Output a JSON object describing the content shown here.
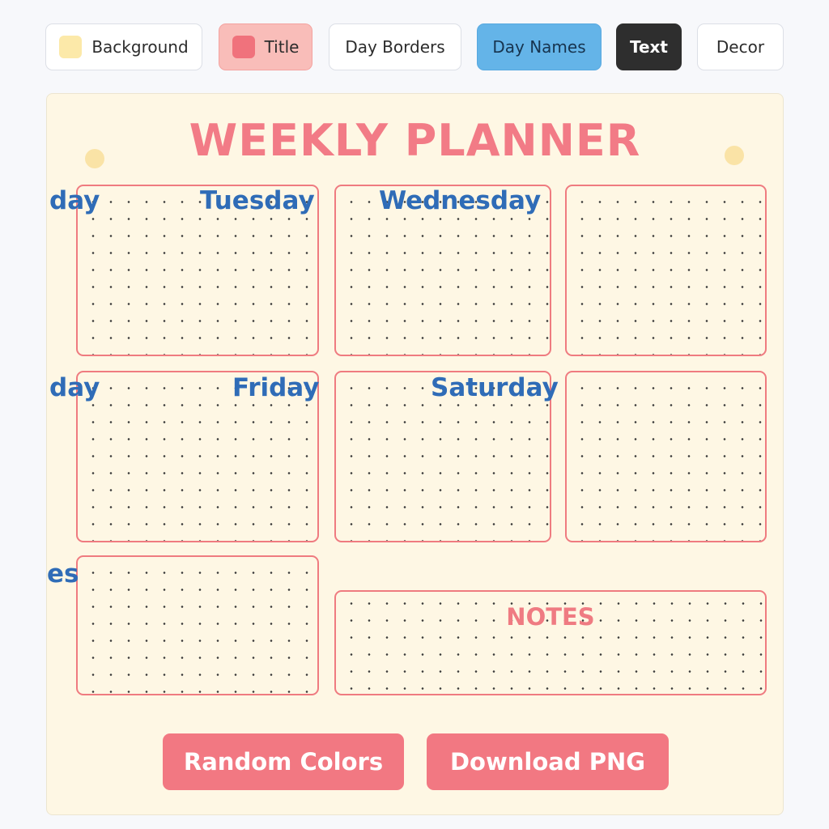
{
  "toolbar": {
    "chips": [
      {
        "label": "Background",
        "swatch": "#fce9a9"
      },
      {
        "label": "Title",
        "swatch": "#f0727c"
      },
      {
        "label": "Day Borders"
      },
      {
        "label": "Day Names"
      },
      {
        "label": "Text"
      },
      {
        "label": "Decor"
      }
    ]
  },
  "planner": {
    "title": "WEEKLY PLANNER",
    "days": {
      "cut_row1": "day",
      "tuesday": "Tuesday",
      "wednesday": "Wednesday",
      "cut_row2": "day",
      "friday": "Friday",
      "saturday": "Saturday",
      "cut_row3": "es"
    },
    "notes_label": "NOTES"
  },
  "actions": {
    "random_label": "Random Colors",
    "download_label": "Download PNG"
  },
  "colors": {
    "background": "#fef7e4",
    "title": "#f27b86",
    "day_border": "#ef7b80",
    "day_name": "#2f6cb7",
    "button": "#f27882"
  }
}
